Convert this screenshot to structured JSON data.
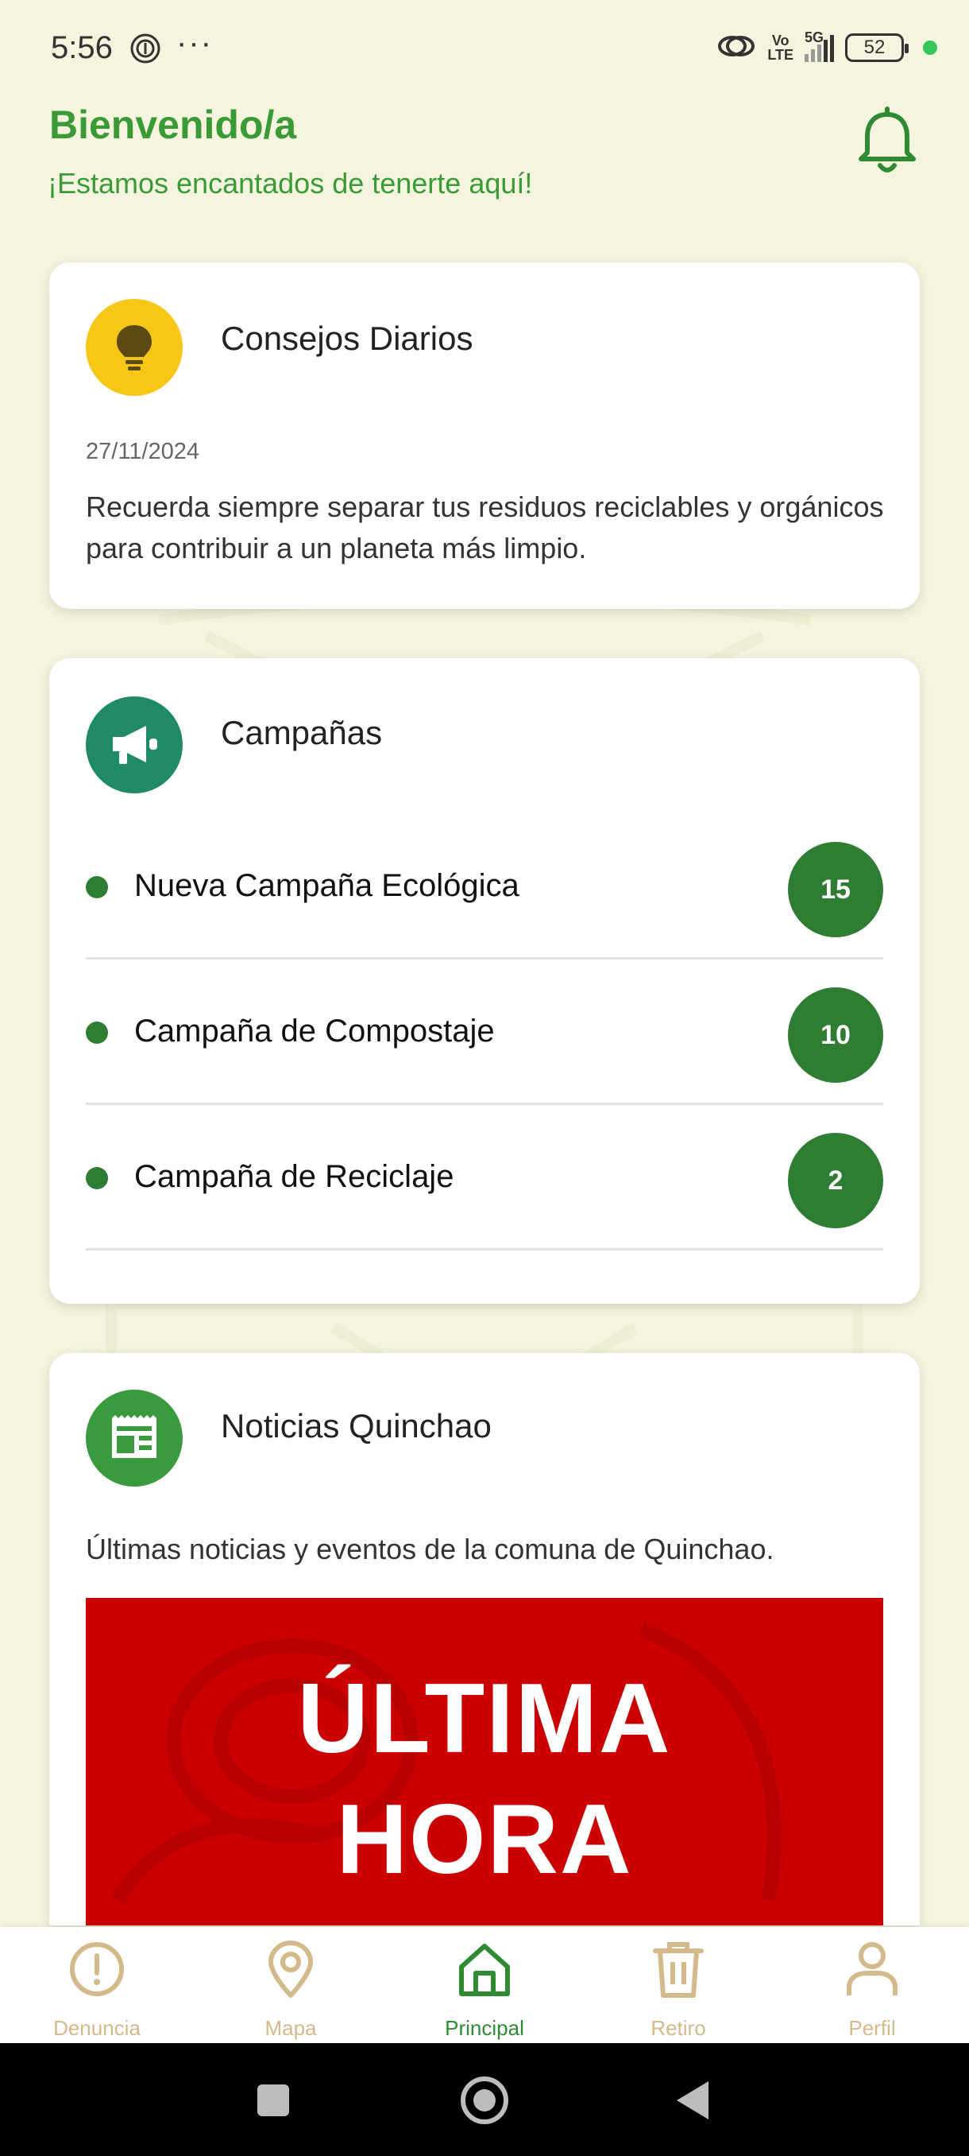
{
  "status_bar": {
    "time": "5:56",
    "dots": "···",
    "net_volte_top": "Vo",
    "net_volte_bottom": "LTE",
    "net_5g": "5G",
    "battery": "52"
  },
  "header": {
    "title": "Bienvenido/a",
    "subtitle": "¡Estamos encantados de tenerte aquí!"
  },
  "tips_card": {
    "title": "Consejos Diarios",
    "date": "27/11/2024",
    "text": "Recuerda siempre separar tus residuos reciclables y orgánicos para contribuir a un planeta más limpio.",
    "icon": "lightbulb-icon"
  },
  "campaigns_card": {
    "title": "Campañas",
    "icon": "megaphone-icon",
    "items": [
      {
        "label": "Nueva Campaña Ecológica",
        "count": "15"
      },
      {
        "label": "Campaña de Compostaje",
        "count": "10"
      },
      {
        "label": "Campaña de Reciclaje",
        "count": "2"
      }
    ]
  },
  "news_card": {
    "title": "Noticias Quinchao",
    "icon": "newspaper-icon",
    "description": "Últimas noticias y eventos de la comuna de Quinchao.",
    "banner_line1": "ÚLTIMA",
    "banner_line2": "HORA"
  },
  "bottom_nav": {
    "active": "Principal",
    "items": [
      {
        "label": "Denuncia",
        "icon": "alert-circle-icon"
      },
      {
        "label": "Mapa",
        "icon": "map-pin-icon"
      },
      {
        "label": "Principal",
        "icon": "home-icon"
      },
      {
        "label": "Retiro",
        "icon": "trash-icon"
      },
      {
        "label": "Perfil",
        "icon": "user-icon"
      }
    ]
  },
  "colors": {
    "background": "#f5f4de",
    "accent_green": "#3a9a35",
    "badge_green": "#2e7d32",
    "tips_yellow": "#f8c617",
    "campaign_teal": "#1f8a63",
    "nav_inactive": "#d4b98a",
    "banner_red": "#cc0000"
  }
}
